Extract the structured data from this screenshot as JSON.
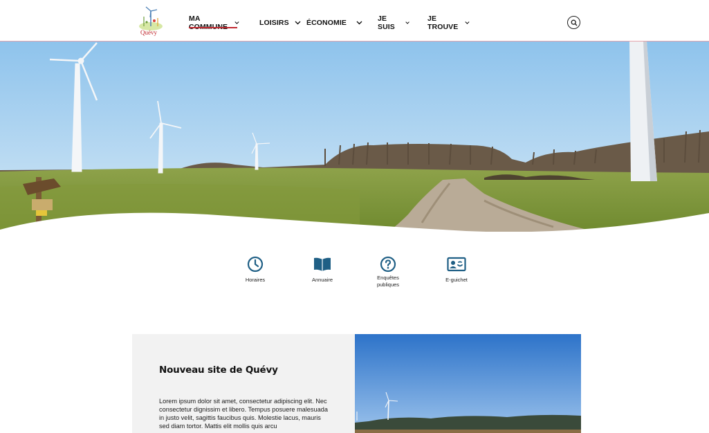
{
  "header": {
    "logo_text": "Quévy",
    "nav": [
      {
        "label": "MA COMMUNE",
        "active": true
      },
      {
        "label": "LOISIRS"
      },
      {
        "label": "ÉCONOMIE"
      },
      {
        "label": "JE SUIS"
      },
      {
        "label": "JE TROUVE"
      }
    ],
    "search_icon": "search-icon",
    "accent_color": "#c0282f"
  },
  "hero": {
    "image": "wind-turbines-field"
  },
  "quick_links": [
    {
      "label": "Horaires",
      "icon": "clock-icon"
    },
    {
      "label": "Annuaire",
      "icon": "book-icon"
    },
    {
      "label": "Enquêtes publiques",
      "icon": "question-icon"
    },
    {
      "label": "E-guichet",
      "icon": "contact-card-icon"
    }
  ],
  "quick_link_color": "#1f5f85",
  "news": {
    "title": "Nouveau site de Quévy",
    "body": "Lorem ipsum dolor sit amet, consectetur adipiscing elit. Nec consectetur dignissim et libero. Tempus posuere malesuada in justo velit, sagittis faucibus quis. Molestie lacus, mauris sed diam tortor. Mattis elit mollis quis arcu"
  }
}
